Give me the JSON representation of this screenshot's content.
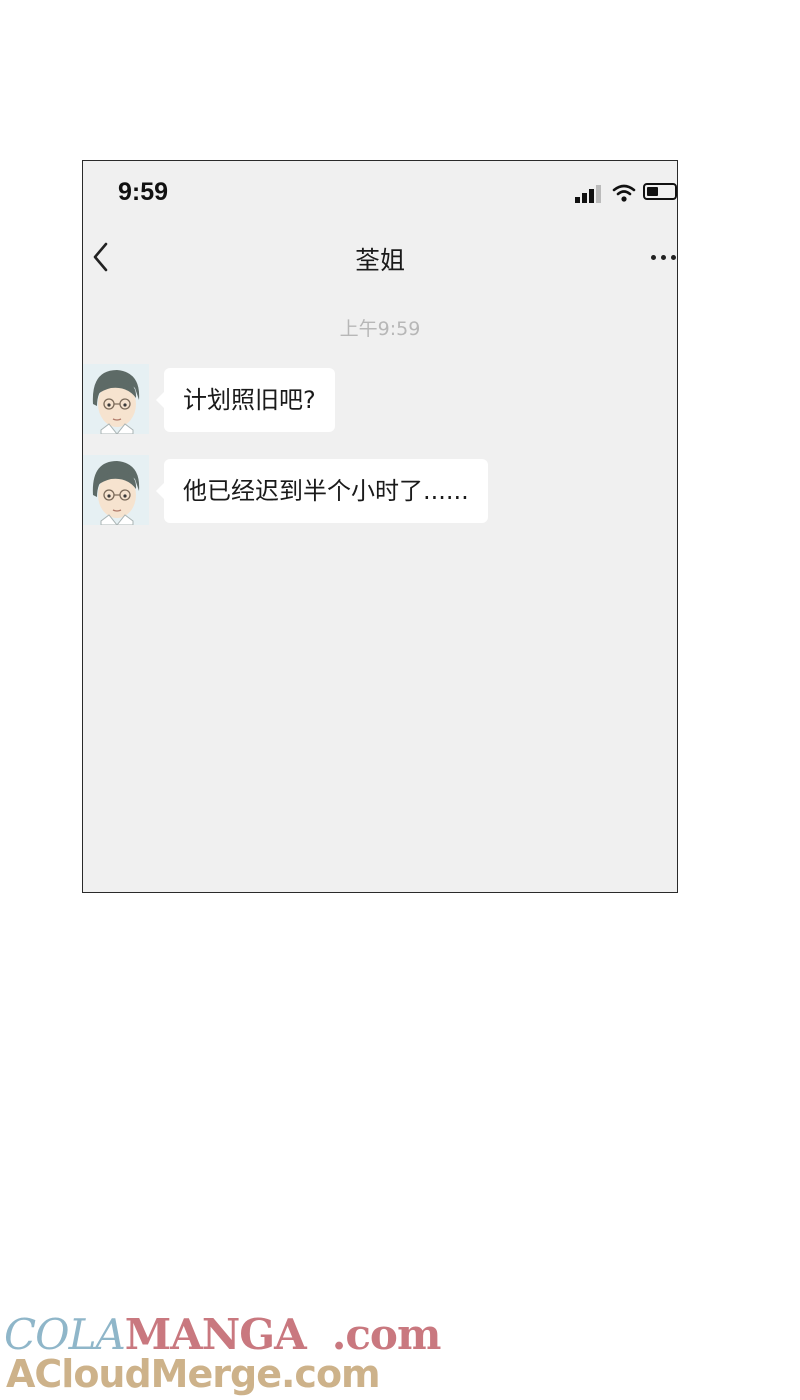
{
  "status_bar": {
    "time": "9:59",
    "icons": [
      "signal-icon",
      "wifi-icon",
      "battery-icon"
    ]
  },
  "header": {
    "title": "荃姐",
    "back_icon": "chevron-left-icon",
    "more_icon": "more-icon"
  },
  "chat": {
    "timestamp": "上午9:59",
    "messages": [
      {
        "sender": "incoming",
        "text": "计划照旧吧?"
      },
      {
        "sender": "incoming",
        "text": "他已经迟到半个小时了......"
      }
    ]
  },
  "watermark": {
    "line1_a": "COLA",
    "line1_b": "MANGA",
    "line1_c": ".com",
    "line2": "ACloudMerge.com"
  },
  "colors": {
    "chat_background": "#f0f0f0",
    "bubble": "#ffffff",
    "timestamp_text": "#b7b7b7"
  }
}
